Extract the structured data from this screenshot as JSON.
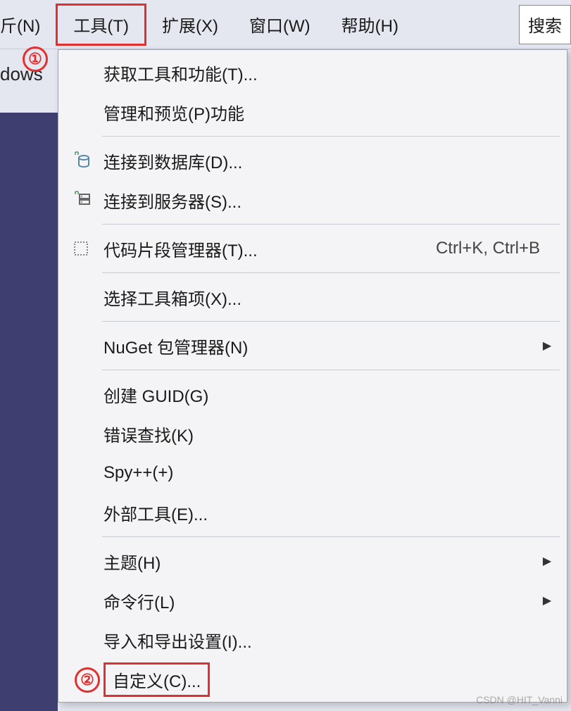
{
  "menubar": {
    "left_cut_item": "斤(N)",
    "items": [
      {
        "label": "工具(T)",
        "highlighted": true
      },
      {
        "label": "扩展(X)"
      },
      {
        "label": "窗口(W)"
      },
      {
        "label": "帮助(H)"
      }
    ],
    "search_label": "搜索"
  },
  "secondary": {
    "left_text": "dows"
  },
  "callouts": {
    "one": "①",
    "two": "②"
  },
  "dropdown": {
    "groups": [
      [
        {
          "icon": "",
          "label": "获取工具和功能(T)..."
        },
        {
          "icon": "",
          "label": "管理和预览(P)功能"
        }
      ],
      [
        {
          "icon": "db",
          "label": "连接到数据库(D)..."
        },
        {
          "icon": "server",
          "label": "连接到服务器(S)..."
        }
      ],
      [
        {
          "icon": "square",
          "label": "代码片段管理器(T)...",
          "shortcut": "Ctrl+K, Ctrl+B"
        }
      ],
      [
        {
          "icon": "",
          "label": "选择工具箱项(X)..."
        }
      ],
      [
        {
          "icon": "",
          "label": "NuGet 包管理器(N)",
          "submenu": true
        }
      ],
      [
        {
          "icon": "",
          "label": "创建 GUID(G)"
        },
        {
          "icon": "",
          "label": "错误查找(K)"
        },
        {
          "icon": "",
          "label": "Spy++(+)"
        },
        {
          "icon": "",
          "label": "外部工具(E)..."
        }
      ],
      [
        {
          "icon": "",
          "label": "主题(H)",
          "submenu": true
        },
        {
          "icon": "",
          "label": "命令行(L)",
          "submenu": true
        },
        {
          "icon": "",
          "label": "导入和导出设置(I)..."
        },
        {
          "icon": "",
          "label": "自定义(C)...",
          "highlighted": true
        }
      ]
    ]
  },
  "watermark": "CSDN @HIT_Vanni"
}
